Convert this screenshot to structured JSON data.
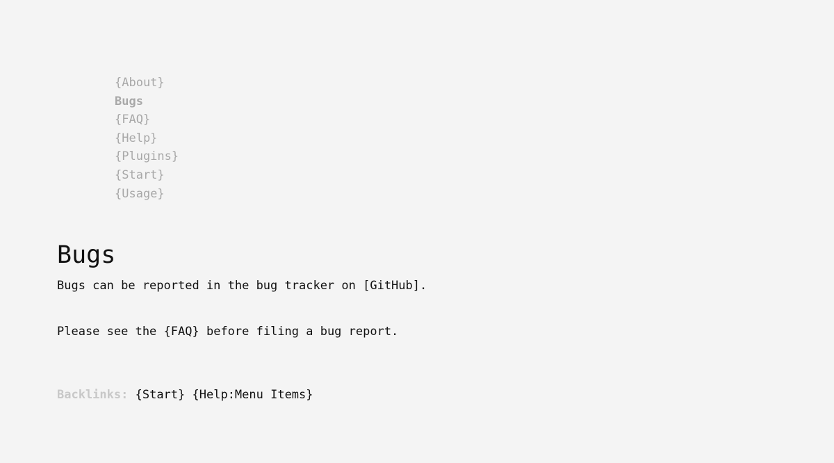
{
  "nav": {
    "items": [
      {
        "label": "{About}"
      },
      {
        "label": "Bugs"
      },
      {
        "label": "{FAQ}"
      },
      {
        "label": "{Help}"
      },
      {
        "label": "{Plugins}"
      },
      {
        "label": "{Start}"
      },
      {
        "label": "{Usage}"
      }
    ]
  },
  "page": {
    "title": "Bugs",
    "paragraph_1": {
      "before": "Bugs can be reported in the bug tracker on ",
      "link": "[GitHub]",
      "after": "."
    },
    "paragraph_2": {
      "before": "Please see the ",
      "link": "{FAQ}",
      "after": " before filing a bug report."
    }
  },
  "backlinks": {
    "label": "Backlinks:",
    "links": [
      "{Start}",
      "{Help:Menu Items}"
    ]
  }
}
